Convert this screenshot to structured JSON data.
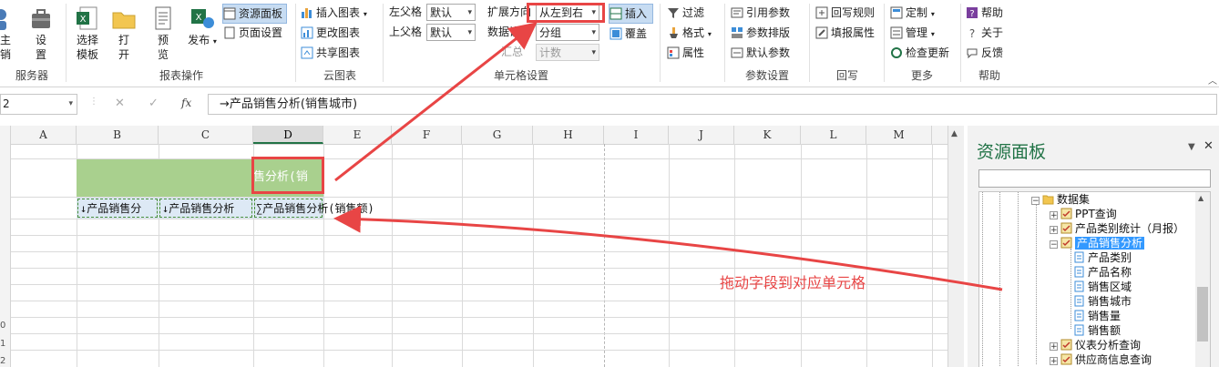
{
  "ribbon": {
    "server_group": {
      "label": "服务器",
      "btn1": "主\n销",
      "btn2": "设\n置"
    },
    "report_group": {
      "label": "报表操作",
      "select_template": "选择\n模板",
      "open": "打\n开",
      "preview": "预\n览",
      "publish": "发布"
    },
    "resource_panel_btn": "资源面板",
    "page_setup_btn": "页面设置",
    "cloud_group": {
      "label": "云图表",
      "insert_chart": "插入图表",
      "change_chart": "更改图表",
      "share_chart": "共享图表"
    },
    "cell_group": {
      "label": "单元格设置",
      "left_parent_label": "左父格",
      "left_parent_value": "默认",
      "top_parent_label": "上父格",
      "top_parent_value": "默认",
      "expand_dir_label": "扩展方向",
      "expand_dir_value": "从左到右",
      "data_setting_label": "数据设置",
      "data_setting_value": "分组",
      "summary_label": "汇总",
      "summary_value": "计数",
      "insert": "插入",
      "override": "覆盖"
    },
    "filter_group": {
      "filter": "过滤",
      "format": "格式",
      "property": "属性"
    },
    "param_group": {
      "label": "参数设置",
      "ref_param": "引用参数",
      "param_layout": "参数排版",
      "default_param": "默认参数"
    },
    "writeback_group": {
      "label": "回写",
      "rule": "回写规则",
      "fill_prop": "填报属性"
    },
    "more_group": {
      "label": "更多",
      "customize": "定制",
      "manage": "管理",
      "check_update": "检查更新"
    },
    "help_group": {
      "label": "帮助",
      "help": "帮助",
      "about": "关于",
      "feedback": "反馈"
    }
  },
  "formula_bar": {
    "name_box": "2",
    "cancel": "✕",
    "confirm": "✓",
    "fx": "fx",
    "formula": "→产品销售分析(销售城市)"
  },
  "grid": {
    "columns": [
      "A",
      "B",
      "C",
      "D",
      "E",
      "F",
      "G",
      "H",
      "I",
      "J",
      "K",
      "L",
      "M"
    ],
    "selected_column": "D",
    "row_numbers": [
      "0",
      "1",
      "2"
    ],
    "cells": {
      "d_header": "售分析(销",
      "b_row": "↓产品销售分",
      "c_row": "↓产品销售分析",
      "d_row": "∑产品销售分析(销售额)"
    }
  },
  "annotation": "拖动字段到对应单元格",
  "panel": {
    "title": "资源面板",
    "pin": "▼",
    "close": "✕",
    "search_placeholder": "",
    "tree": [
      {
        "label": "数据集",
        "type": "folder",
        "expanded": true
      },
      {
        "label": "PPT查询",
        "type": "dataset"
      },
      {
        "label": "产品类别统计（月报）",
        "type": "dataset"
      },
      {
        "label": "产品销售分析",
        "type": "dataset",
        "expanded": true,
        "selected": true
      },
      {
        "label": "产品类别",
        "type": "field"
      },
      {
        "label": "产品名称",
        "type": "field"
      },
      {
        "label": "销售区域",
        "type": "field"
      },
      {
        "label": "销售城市",
        "type": "field"
      },
      {
        "label": "销售量",
        "type": "field"
      },
      {
        "label": "销售额",
        "type": "field"
      },
      {
        "label": "仪表分析查询",
        "type": "dataset"
      },
      {
        "label": "供应商信息查询",
        "type": "dataset"
      }
    ]
  },
  "colors": {
    "green_fill": "#a9d08e",
    "accent": "#217346",
    "red": "#e84545",
    "select_blue": "#3399ff"
  }
}
